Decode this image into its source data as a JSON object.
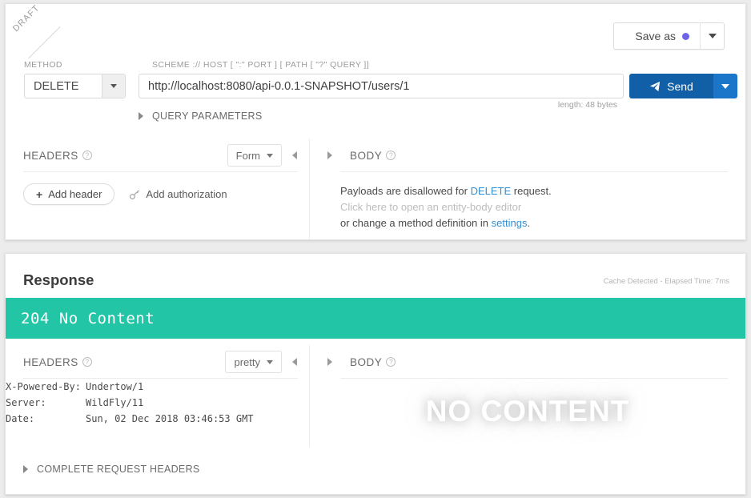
{
  "request": {
    "ribbon_label": "DRAFT",
    "save_as": {
      "label": "Save as",
      "dot_color": "#6c63e8"
    },
    "method": {
      "label": "METHOD",
      "value": "DELETE"
    },
    "url": {
      "label": "SCHEME :// HOST [ \":\" PORT ] [ PATH [ \"?\" QUERY ]]",
      "value": "http://localhost:8080/api-0.0.1-SNAPSHOT/users/1",
      "length_note": "length: 48 bytes"
    },
    "send": {
      "label": "Send",
      "icon": "paper-plane-icon"
    },
    "query_parameters": {
      "label": "QUERY PARAMETERS"
    },
    "headers_pane": {
      "title": "HEADERS",
      "help": "?",
      "format_select": "Form",
      "add_header": "Add header",
      "add_authorization": "Add authorization"
    },
    "body_pane": {
      "title": "BODY",
      "help": "?",
      "line1_prefix": "Payloads are disallowed for ",
      "line1_link": "DELETE",
      "line1_suffix": " request.",
      "line2": "Click here to open an entity-body editor",
      "line3_prefix": "or change a method definition in ",
      "line3_link": "settings",
      "line3_suffix": "."
    }
  },
  "response": {
    "title": "Response",
    "meta": "Cache Detected - Elapsed Time: 7ms",
    "status": {
      "text": "204 No Content",
      "color": "#22c5a5"
    },
    "headers_pane": {
      "title": "HEADERS",
      "help": "?",
      "format_select": "pretty",
      "rows": [
        {
          "key": "X-Powered-By:",
          "value": "Undertow/1"
        },
        {
          "key": "Server:",
          "value": "WildFly/11"
        },
        {
          "key": "Date:",
          "value": "Sun, 02 Dec 2018 03:46:53 GMT"
        }
      ]
    },
    "body_pane": {
      "title": "BODY",
      "help": "?",
      "watermark": "NO CONTENT"
    },
    "complete_request_headers": {
      "label": "COMPLETE REQUEST HEADERS"
    }
  }
}
